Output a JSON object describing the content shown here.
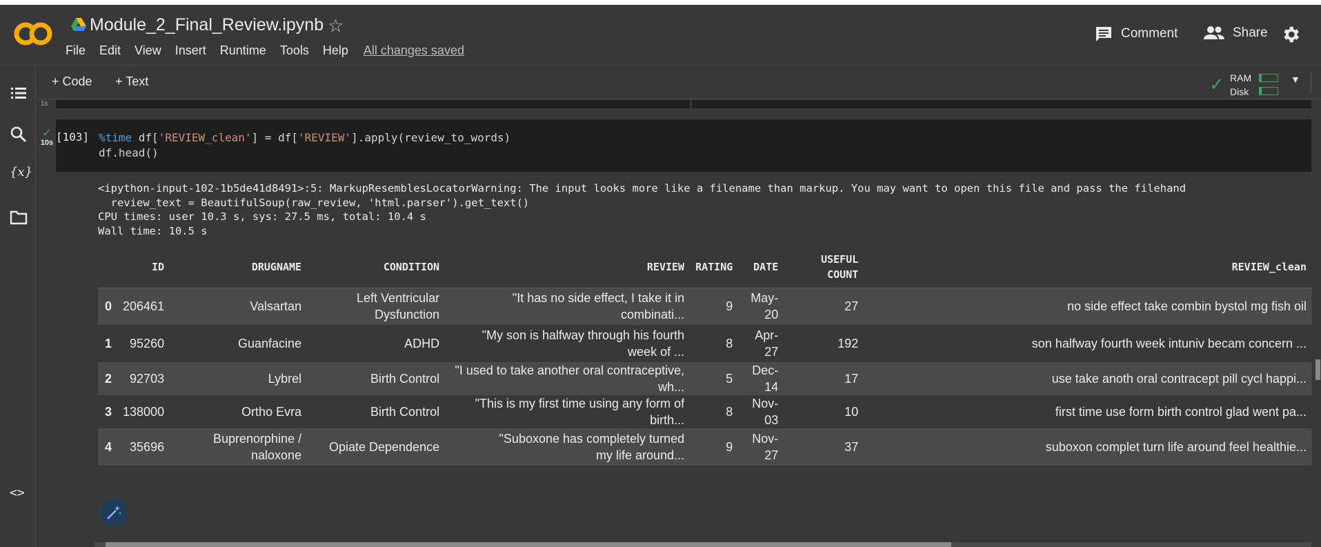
{
  "header": {
    "notebook_title": "Module_2_Final_Review.ipynb",
    "menu": [
      "File",
      "Edit",
      "View",
      "Insert",
      "Runtime",
      "Tools",
      "Help"
    ],
    "save_status": "All changes saved",
    "comment_label": "Comment",
    "share_label": "Share"
  },
  "toolbar": {
    "add_code_label": "+ Code",
    "add_text_label": "+ Text",
    "ram_label": "RAM",
    "disk_label": "Disk"
  },
  "sidebar": {
    "items": [
      "table-of-contents-icon",
      "search-icon",
      "variables-icon",
      "files-icon"
    ],
    "bottom": "code-snippets-icon"
  },
  "previous_cell": {
    "status": "1s"
  },
  "cell": {
    "exec_count": "[103]",
    "run_time": "10s",
    "code_line1_magic": "%time",
    "code_line1_a": " df[",
    "code_line1_str1": "'REVIEW_clean'",
    "code_line1_b": "] = df[",
    "code_line1_str2": "'REVIEW'",
    "code_line1_c": "].apply(review_to_words)",
    "code_line2": "df.head()"
  },
  "output": {
    "lines": [
      "<ipython-input-102-1b5de41d8491>:5: MarkupResemblesLocatorWarning: The input looks more like a filename than markup. You may want to open this file and pass the filehand",
      "  review_text = BeautifulSoup(raw_review, 'html.parser').get_text()",
      "CPU times: user 10.3 s, sys: 27.5 ms, total: 10.4 s",
      "Wall time: 10.5 s"
    ]
  },
  "dataframe": {
    "columns": [
      "",
      "ID",
      "DRUGNAME",
      "CONDITION",
      "REVIEW",
      "RATING",
      "DATE",
      "USEFUL COUNT",
      "REVIEW_clean"
    ],
    "rows": [
      [
        "0",
        "206461",
        "Valsartan",
        "Left Ventricular Dysfunction",
        "\"It has no side effect, I take it in combinati...",
        "9",
        "May-20",
        "27",
        "no side effect take combin bystol mg fish oil"
      ],
      [
        "1",
        "95260",
        "Guanfacine",
        "ADHD",
        "\"My son is halfway through his fourth week of ...",
        "8",
        "Apr-27",
        "192",
        "son halfway fourth week intuniv becam concern ..."
      ],
      [
        "2",
        "92703",
        "Lybrel",
        "Birth Control",
        "\"I used to take another oral contraceptive, wh...",
        "5",
        "Dec-14",
        "17",
        "use take anoth oral contracept pill cycl happi..."
      ],
      [
        "3",
        "138000",
        "Ortho Evra",
        "Birth Control",
        "\"This is my first time using any form of birth...",
        "8",
        "Nov-03",
        "10",
        "first time use form birth control glad went pa..."
      ],
      [
        "4",
        "35696",
        "Buprenorphine / naloxone",
        "Opiate Dependence",
        "\"Suboxone has completely turned my life around...",
        "9",
        "Nov-27",
        "37",
        "suboxon complet turn life around feel healthie..."
      ]
    ]
  },
  "colors": {
    "accent_orange": "#f9ab00",
    "success_green": "#34a853",
    "code_bg": "#1e1e1e",
    "page_bg": "#383838"
  }
}
